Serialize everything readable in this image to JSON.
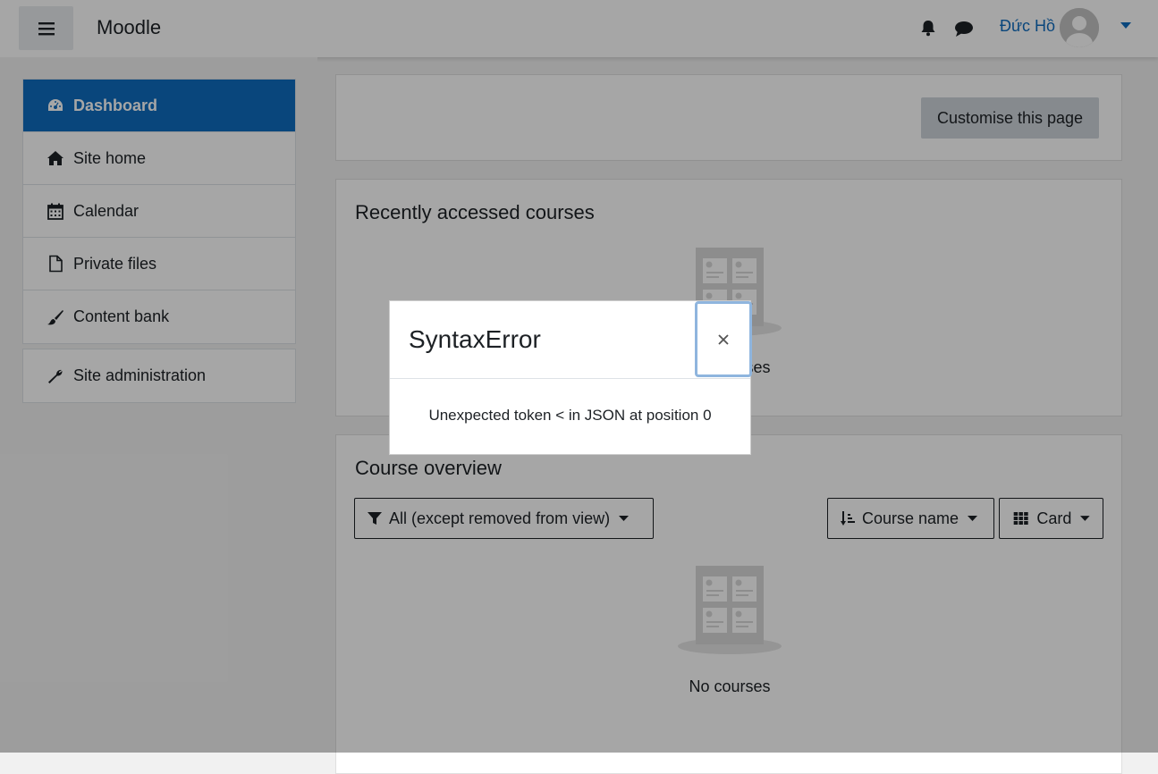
{
  "navbar": {
    "brand": "Moodle",
    "user_name": "Đức Hồ"
  },
  "drawer": {
    "items": [
      {
        "label": "Dashboard",
        "icon": "dashboard-icon",
        "active": true
      },
      {
        "label": "Site home",
        "icon": "home-icon"
      },
      {
        "label": "Calendar",
        "icon": "calendar-icon"
      },
      {
        "label": "Private files",
        "icon": "file-icon"
      },
      {
        "label": "Content bank",
        "icon": "paintbrush-icon"
      }
    ],
    "admin": {
      "label": "Site administration",
      "icon": "wrench-icon"
    }
  },
  "main": {
    "customise_label": "Customise this page",
    "recent": {
      "title": "Recently accessed courses",
      "empty_text": "No courses"
    },
    "overview": {
      "title": "Course overview",
      "filter_label": "All (except removed from view)",
      "sort_label": "Course name",
      "view_label": "Card",
      "empty_text": "No courses"
    }
  },
  "modal": {
    "title": "SyntaxError",
    "message": "Unexpected token < in JSON at position 0",
    "close_symbol": "×"
  },
  "colors": {
    "brand_blue": "#0f6cbf",
    "backdrop": "rgba(0,0,0,0.35)",
    "focus_ring": "#8fb5de"
  }
}
